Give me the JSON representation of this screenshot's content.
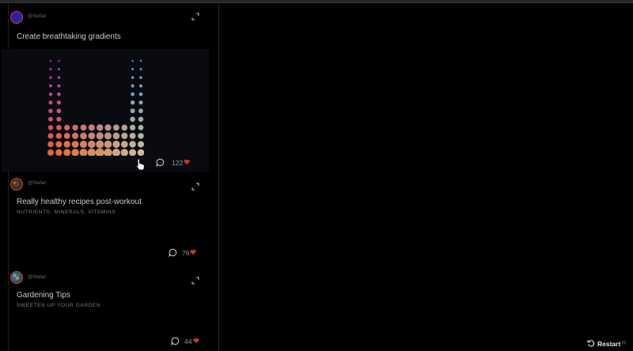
{
  "posts": [
    {
      "handle": "@Stefan",
      "title": "Create breathtaking gradients",
      "subtitle": "",
      "comments_count": "122",
      "avatar": "solid-blue-avatar",
      "has_preview": true
    },
    {
      "handle": "@Stefan",
      "title": "Really healthy recipes post-workout",
      "subtitle": "NUTRIENTS, MINERALS, VITAMINS",
      "comments_count": "76",
      "avatar": "food-photo-avatar",
      "has_preview": false
    },
    {
      "handle": "@Stefan",
      "title": "Gardening Tips",
      "subtitle": "SWEETEN UP YOUR GARDEN",
      "comments_count": "44",
      "avatar": "garden-photo-avatar",
      "has_preview": false
    }
  ],
  "icons": {
    "expand": "expand-icon",
    "comment": "comment-icon",
    "like": "heart-icon",
    "restart": "restart-icon",
    "cursor": "pointer-cursor-icon"
  },
  "colors": {
    "background": "#000000",
    "heart": "#c0392b",
    "avatar_ring": "#d04a3a",
    "preview_bg": "#0a0b10"
  },
  "footer": {
    "restart_label": "Restart",
    "restart_key": "R"
  }
}
